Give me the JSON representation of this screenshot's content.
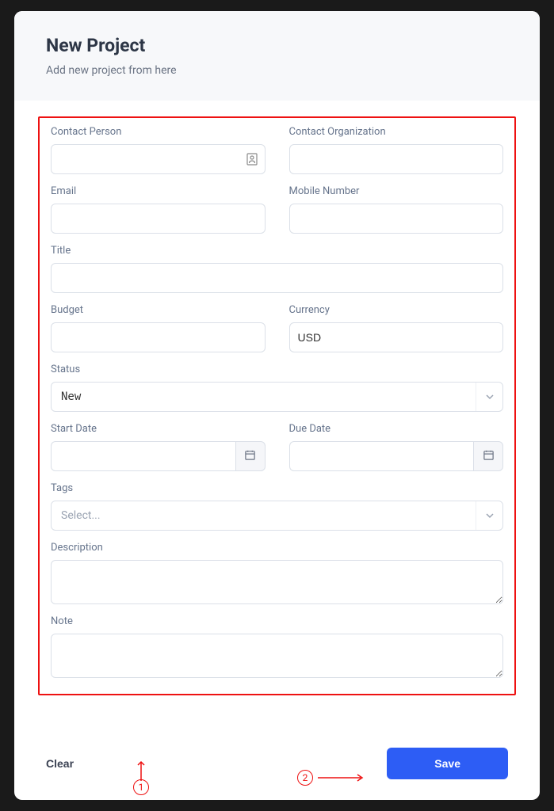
{
  "header": {
    "title": "New Project",
    "subtitle": "Add new project from here"
  },
  "fields": {
    "contact_person": {
      "label": "Contact Person",
      "value": ""
    },
    "contact_organization": {
      "label": "Contact Organization",
      "value": ""
    },
    "email": {
      "label": "Email",
      "value": ""
    },
    "mobile_number": {
      "label": "Mobile Number",
      "value": ""
    },
    "title": {
      "label": "Title",
      "value": ""
    },
    "budget": {
      "label": "Budget",
      "value": ""
    },
    "currency": {
      "label": "Currency",
      "value": "USD"
    },
    "status": {
      "label": "Status",
      "value": "New"
    },
    "start_date": {
      "label": "Start Date",
      "value": ""
    },
    "due_date": {
      "label": "Due Date",
      "value": ""
    },
    "tags": {
      "label": "Tags",
      "placeholder": "Select..."
    },
    "description": {
      "label": "Description",
      "value": ""
    },
    "note": {
      "label": "Note",
      "value": ""
    }
  },
  "footer": {
    "clear_label": "Clear",
    "save_label": "Save"
  },
  "annotations": {
    "marker1": "1",
    "marker2": "2"
  }
}
